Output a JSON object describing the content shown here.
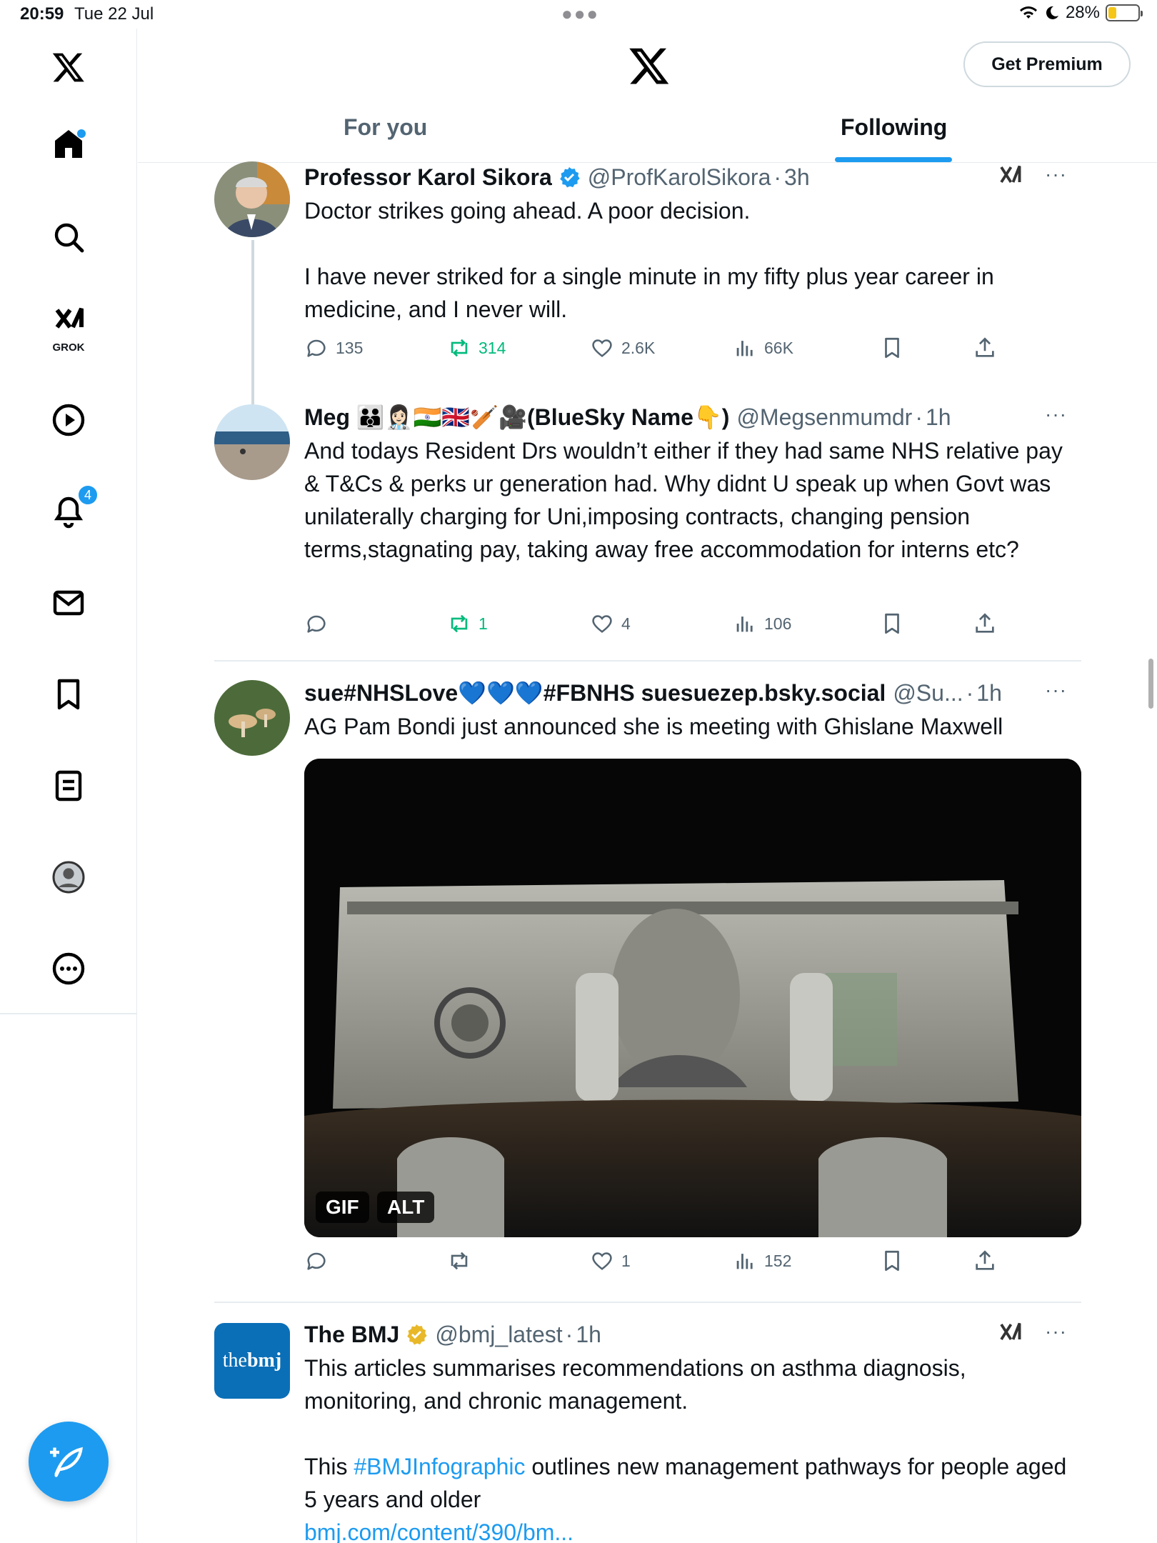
{
  "status_bar": {
    "time": "20:59",
    "date": "Tue 22 Jul",
    "battery": "28%",
    "battery_level": 0.28
  },
  "header": {
    "premium_label": "Get Premium",
    "tabs": [
      "For you",
      "Following"
    ],
    "active_tab": "Following"
  },
  "rail": {
    "grok_label": "GROK",
    "notifications_count": "4"
  },
  "tweets": [
    {
      "name": "Professor Karol Sikora",
      "handle": "@ProfKarolSikora",
      "time": "3h",
      "text": [
        "Doctor strikes going ahead. A poor decision.",
        "I have never striked for a single minute in my fifty plus year career in medicine, and I never will."
      ],
      "stats": {
        "replies": "135",
        "reposts": "314",
        "likes": "2.6K",
        "views": "66K"
      }
    },
    {
      "name": "Meg 👪👩🏻‍⚕️🇮🇳🇬🇧🏏🎥(BlueSky Name👇)",
      "handle": "@Megsenmumdr",
      "time": "1h",
      "text": [
        "And todays Resident Drs wouldn’t either if they had same NHS relative pay & T&Cs & perks ur generation had. Why didnt U speak up when Govt was unilaterally charging for Uni,imposing contracts, changing pension terms,stagnating pay, taking away free accommodation for interns etc?"
      ],
      "stats": {
        "replies": "",
        "reposts": "1",
        "likes": "4",
        "views": "106"
      }
    },
    {
      "name": "sue#NHSLove💙💙💙#FBNHS suesuezep.bsky.social",
      "handle": "@Su...",
      "time": "1h",
      "text": [
        "AG Pam Bondi just announced she is meeting with Ghislane Maxwell"
      ],
      "media_chips": [
        "GIF",
        "ALT"
      ],
      "stats": {
        "replies": "",
        "reposts": "",
        "likes": "1",
        "views": "152"
      }
    },
    {
      "name": "The BMJ",
      "handle": "@bmj_latest",
      "time": "1h",
      "avatar_text": {
        "the": "the",
        "bmj": "bmj"
      },
      "text": [
        "This articles summarises recommendations on asthma diagnosis, monitoring, and chronic management."
      ],
      "text2_prefix": "This ",
      "hashtag": "#BMJInfographic",
      "text2_suffix": " outlines new management pathways for people aged 5 years and older",
      "link": "bmj.com/content/390/bm..."
    }
  ],
  "colors": {
    "accent": "#1d9bf0",
    "repost_green": "#00ba7c",
    "gold_verified": "#e8b829"
  },
  "icons": [
    "x-logo-icon",
    "home-icon",
    "search-icon",
    "grok-icon",
    "video-icon",
    "bell-icon",
    "mail-icon",
    "bookmark-icon",
    "list-icon",
    "profile-icon",
    "more-circle-icon",
    "compose-icon"
  ]
}
